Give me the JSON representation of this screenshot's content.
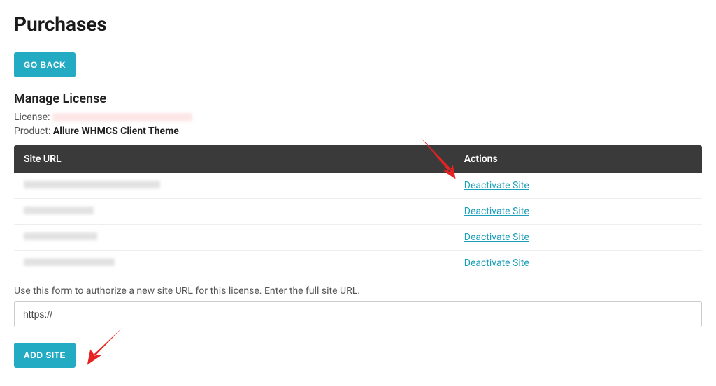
{
  "header": {
    "title": "Purchases"
  },
  "buttons": {
    "go_back": "Go Back",
    "add_site": "Add Site"
  },
  "license_section": {
    "heading": "Manage License",
    "license_label": "License:",
    "product_label": "Product:",
    "product_name": "Allure WHMCS Client Theme"
  },
  "table": {
    "headers": {
      "site_url": "Site URL",
      "actions": "Actions"
    },
    "rows": [
      {
        "url_redacted_class": "w1",
        "action_label": "Deactivate Site"
      },
      {
        "url_redacted_class": "w2",
        "action_label": "Deactivate Site"
      },
      {
        "url_redacted_class": "w3",
        "action_label": "Deactivate Site"
      },
      {
        "url_redacted_class": "w4",
        "action_label": "Deactivate Site"
      }
    ]
  },
  "form": {
    "help_text": "Use this form to authorize a new site URL for this license. Enter the full site URL.",
    "placeholder": "https://",
    "value": "https://"
  },
  "colors": {
    "primary": "#24abc4",
    "header_bar": "#3a3a3a",
    "link": "#1b9fb8",
    "arrow": "#e62222"
  }
}
